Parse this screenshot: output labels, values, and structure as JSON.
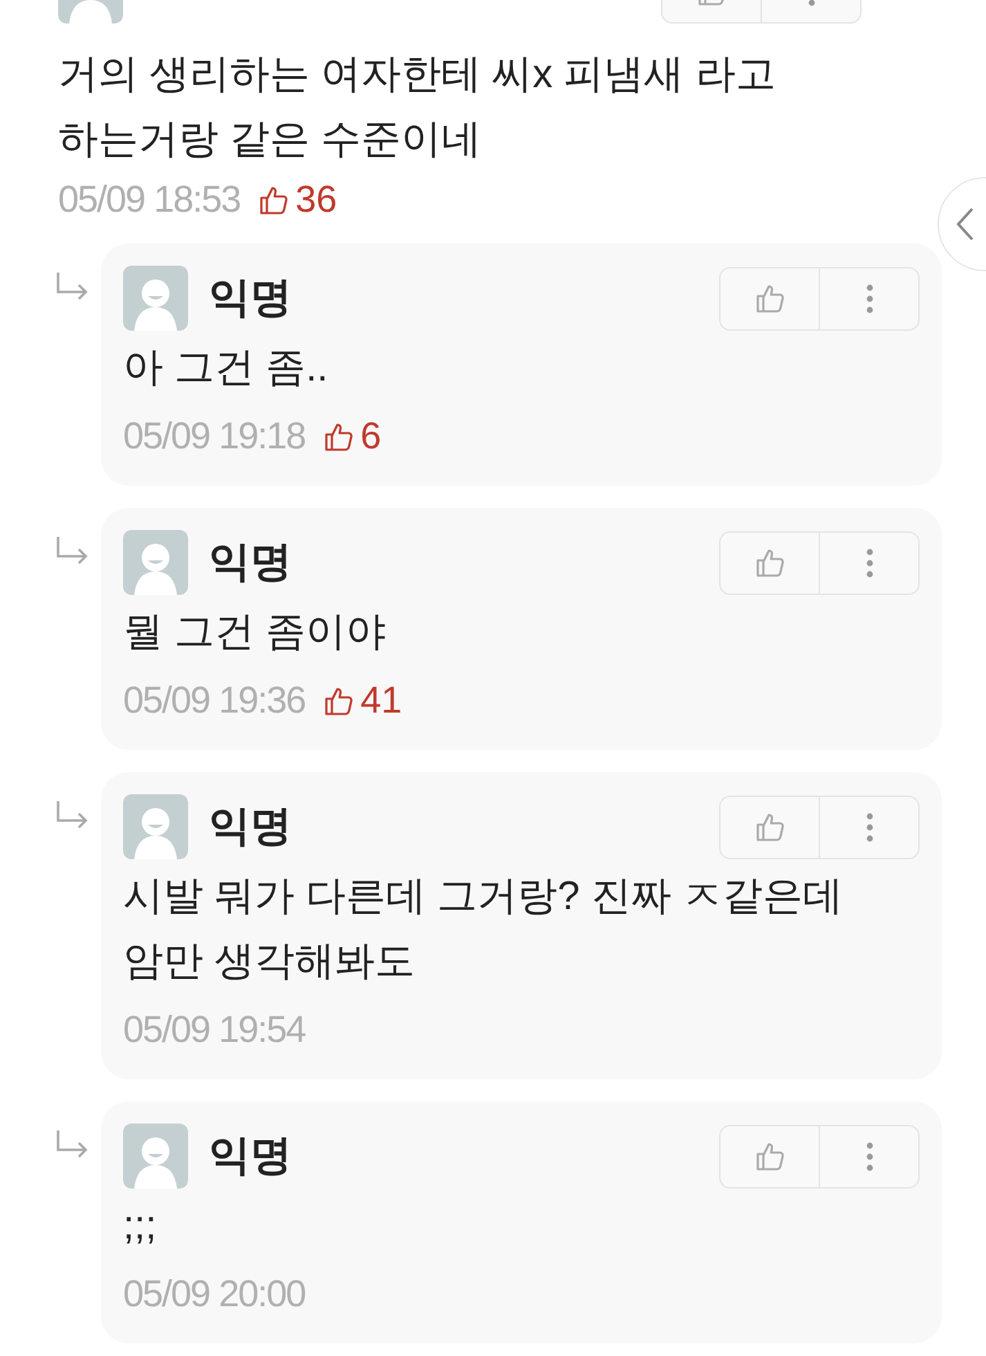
{
  "top_comment": {
    "body": "거의 생리하는 여자한테 씨x 피냄새 라고\n하는거랑 같은 수준이네",
    "time": "05/09 18:53",
    "likes": "36"
  },
  "replies": [
    {
      "author": "익명",
      "body": "아 그건 좀..",
      "time": "05/09 19:18",
      "likes": "6"
    },
    {
      "author": "익명",
      "body": "뭘 그건 좀이야",
      "time": "05/09 19:36",
      "likes": "41"
    },
    {
      "author": "익명",
      "body": "시발 뭐가 다른데 그거랑? 진짜 ㅈ같은데\n암만 생각해봐도",
      "time": "05/09 19:54"
    },
    {
      "author": "익명",
      "body": ";;;",
      "time": "05/09 20:00"
    }
  ]
}
